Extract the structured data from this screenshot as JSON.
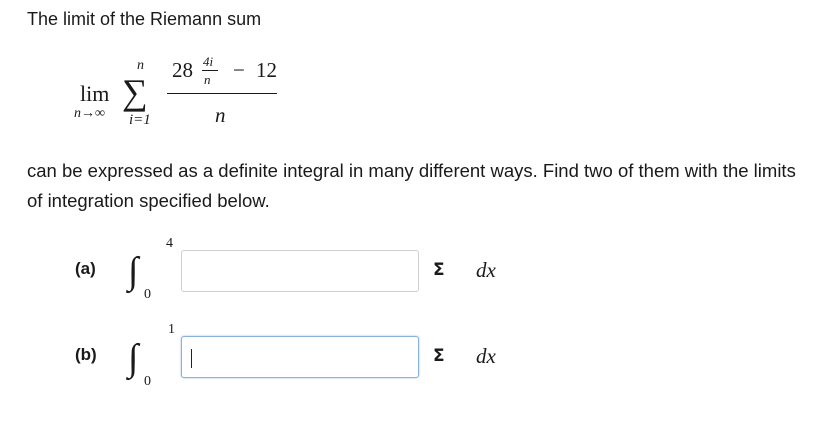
{
  "intro": "The limit of the Riemann sum",
  "expr": {
    "lim": "lim",
    "lim_sub": "n→∞",
    "sigma": "∑",
    "sum_top": "n",
    "sum_bottom": "i=1",
    "coef": "28",
    "exp_num": "4i",
    "exp_den": "n",
    "minus": "−",
    "const": "12",
    "den": "n"
  },
  "description": "can be expressed as a definite integral in many different ways. Find two of them with the limits of integration specified below.",
  "parts": [
    {
      "label": "(a)",
      "integral": "∫",
      "upper": "4",
      "lower": "0",
      "value": "",
      "sigma_icon": "Σ",
      "dx": "dx"
    },
    {
      "label": "(b)",
      "integral": "∫",
      "upper": "1",
      "lower": "0",
      "value": "",
      "sigma_icon": "Σ",
      "dx": "dx"
    }
  ]
}
